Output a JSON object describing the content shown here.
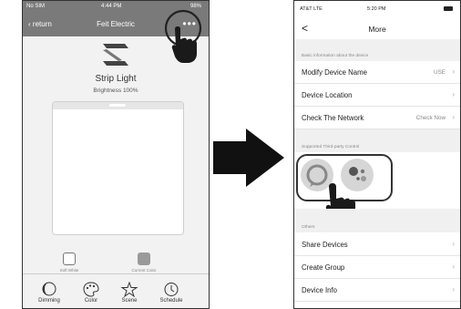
{
  "left_phone": {
    "status": {
      "carrier": "No SIM",
      "time": "4:44 PM",
      "battery": "98%"
    },
    "nav": {
      "back_label": "return",
      "title": "Feit Electric",
      "more_label": "•••"
    },
    "device": {
      "name": "Strip Light",
      "brightness": "Brightness 100%"
    },
    "presets": [
      {
        "label": "Soft White"
      },
      {
        "label": "Current Color"
      }
    ],
    "tabs": [
      {
        "label": "Dimming",
        "icon": "moon-icon"
      },
      {
        "label": "Color",
        "icon": "palette-icon"
      },
      {
        "label": "Scene",
        "icon": "star-icon"
      },
      {
        "label": "Schedule",
        "icon": "clock-icon"
      }
    ]
  },
  "right_phone": {
    "status": {
      "carrier": "AT&T  LTE",
      "time": "5:20 PM"
    },
    "nav": {
      "back_label": "<",
      "title": "More"
    },
    "section_basic": "Basic information about the device",
    "basic_rows": [
      {
        "label": "Modify Device Name",
        "value": "USE"
      },
      {
        "label": "Device Location",
        "value": ""
      },
      {
        "label": "Check The Network",
        "value": "Check Now"
      }
    ],
    "section_third_party": "Supported Third-party Control",
    "assistants": [
      {
        "name": "alexa-icon"
      },
      {
        "name": "google-assistant-icon"
      }
    ],
    "section_others": "Others",
    "other_rows": [
      {
        "label": "Share Devices"
      },
      {
        "label": "Create Group"
      },
      {
        "label": "Device Info"
      }
    ]
  },
  "colors": {
    "nav_gray": "#7a7a7a",
    "outline": "#333333",
    "preset_current": "#9a9a9a"
  }
}
